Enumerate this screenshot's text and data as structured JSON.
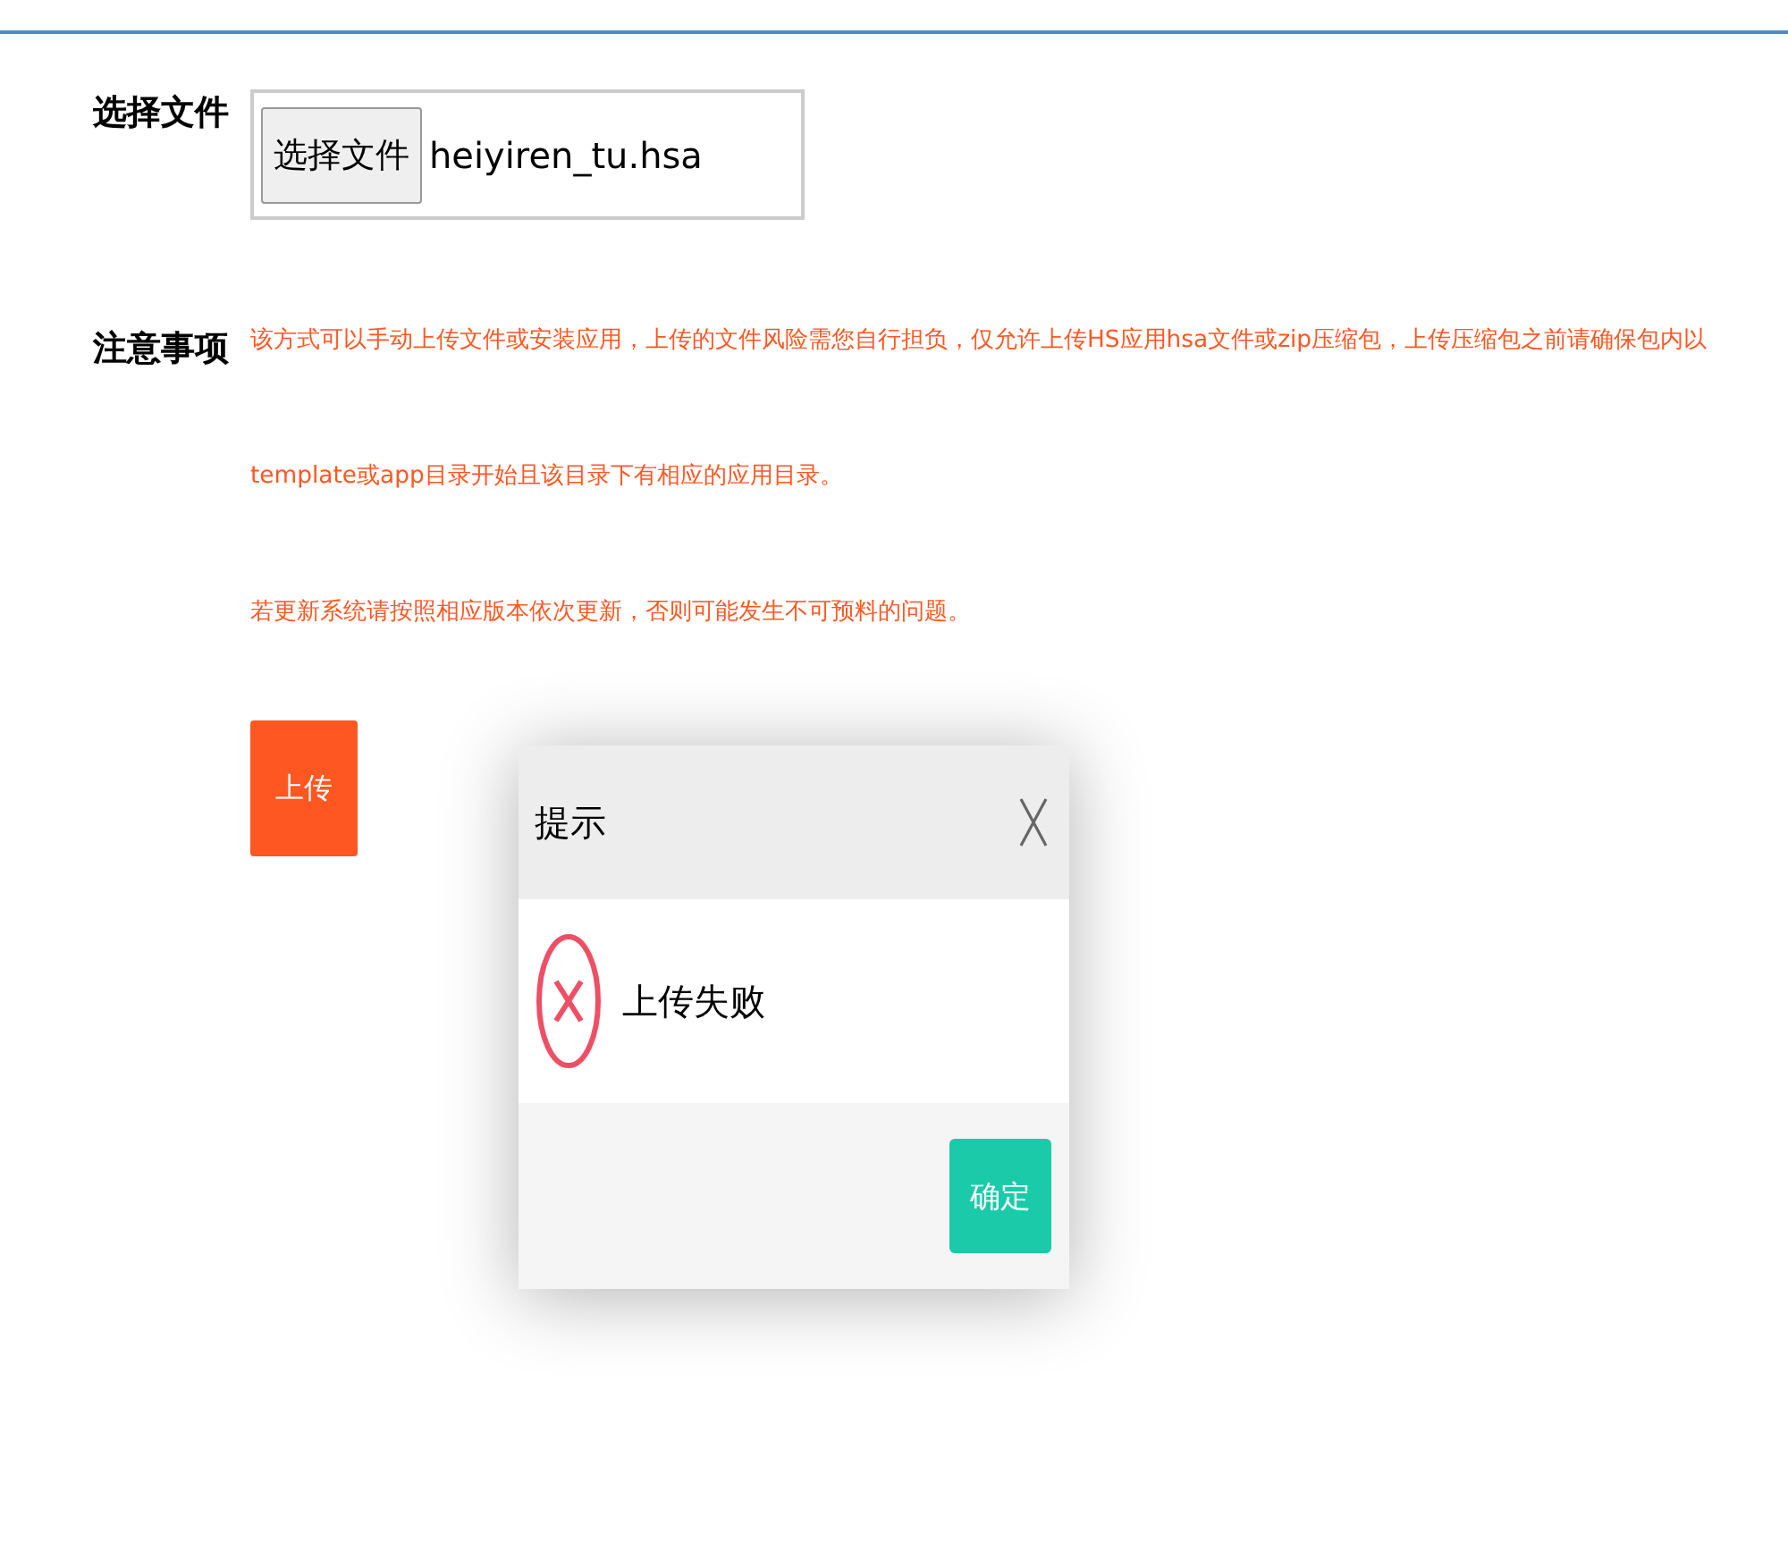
{
  "file_row": {
    "label": "选择文件",
    "button": "选择文件",
    "file_name": "heiyiren_tu.hsa"
  },
  "notes": {
    "label": "注意事项",
    "paragraphs": [
      "该方式可以手动上传文件或安装应用，上传的文件风险需您自行担负，仅允许上传HS应用hsa文件或zip压缩包，上传压缩包之前请确保包内以template或app目录开始且该目录下有相应的应用目录。",
      "若更新系统请按照相应版本依次更新，否则可能发生不可预料的问题。"
    ]
  },
  "upload_button": "上传",
  "dialog": {
    "title": "提示",
    "message": "上传失败",
    "ok": "确定"
  }
}
